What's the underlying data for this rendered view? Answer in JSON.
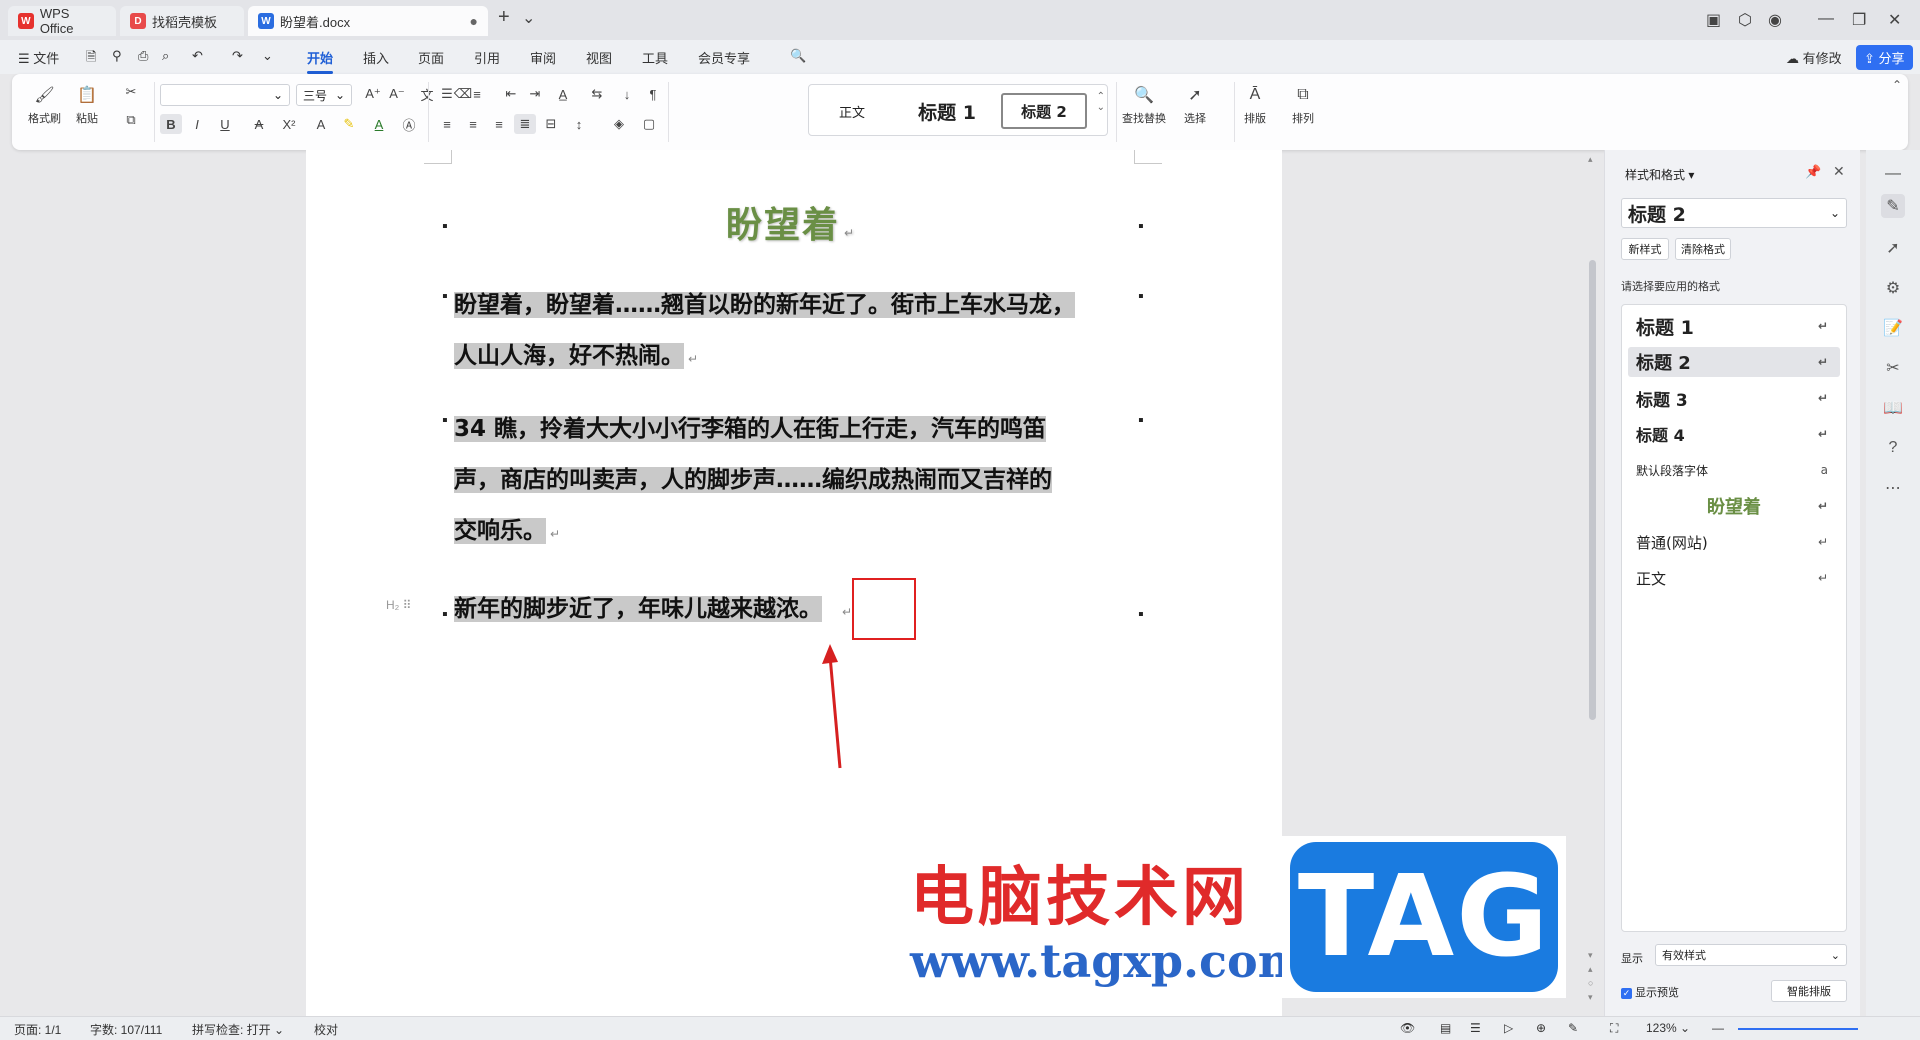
{
  "titlebar": {
    "tabs": [
      {
        "label": "WPS Office",
        "icon": "wps-logo-icon"
      },
      {
        "label": "找稻壳模板",
        "icon": "docer-icon"
      },
      {
        "label": "盼望着.docx",
        "icon": "word-doc-icon"
      }
    ],
    "close_symbol": "●",
    "new_tab": "+",
    "tab_menu": "⌄"
  },
  "menubar": {
    "file": "文件",
    "items": [
      "开始",
      "插入",
      "页面",
      "引用",
      "审阅",
      "视图",
      "工具",
      "会员专享"
    ],
    "active": "开始",
    "modified_label": "有修改",
    "share_label": "分享"
  },
  "ribbon": {
    "format_painter": "格式刷",
    "paste": "粘贴",
    "font_name": "",
    "font_size": "三号",
    "styles": [
      "正文",
      "标题 1",
      "标题 2"
    ],
    "find_replace": "查找替换",
    "select": "选择",
    "layout": "排版",
    "arrange": "排列"
  },
  "document": {
    "title": "盼望着",
    "paragraphs": [
      {
        "lines": [
          "盼望着，盼望着……翘首以盼的新年近了。街市上车水马龙，",
          "人山人海，好不热闹。"
        ]
      },
      {
        "lines": [
          "34 瞧，拎着大大小小行李箱的人在街上行走，汽车的鸣笛",
          "声，商店的叫卖声，人的脚步声……编织成热闹而又吉祥的",
          "交响乐。"
        ]
      },
      {
        "lines": [
          "新年的脚步近了，年味儿越来越浓。"
        ]
      }
    ],
    "paragraph_mark": "↵",
    "heading_marker": "H₂ ⠿"
  },
  "watermark": {
    "site_name": "电脑技术网",
    "url": "www.tagxp.com",
    "tag": "TAG"
  },
  "style_panel": {
    "title": "样式和格式",
    "current_style": "标题 2",
    "new_style": "新样式",
    "clear_format": "清除格式",
    "prompt": "请选择要应用的格式",
    "items": [
      {
        "label": "标题 1",
        "mark": "↵"
      },
      {
        "label": "标题 2",
        "mark": "↵"
      },
      {
        "label": "标题 3",
        "mark": "↵"
      },
      {
        "label": "标题 4",
        "mark": "↵"
      },
      {
        "label": "默认段落字体",
        "mark": "a"
      },
      {
        "label": "盼望着",
        "mark": "↵"
      },
      {
        "label": "普通(网站)",
        "mark": "↵"
      },
      {
        "label": "正文",
        "mark": "↵"
      }
    ],
    "display_label": "显示",
    "display_value": "有效样式",
    "preview_label": "显示预览",
    "smart_layout": "智能排版"
  },
  "statusbar": {
    "page": "页面: 1/1",
    "words": "字数: 107/111",
    "spell": "拼写检查: 打开",
    "proof": "校对",
    "zoom": "123%"
  },
  "colors": {
    "accent": "#1f5fd6",
    "title_green": "#6a8f45",
    "highlight": "#c9c9c9",
    "annotation_red": "#e02020",
    "watermark_red": "#e02a2a",
    "watermark_blue": "#2a66c8"
  }
}
